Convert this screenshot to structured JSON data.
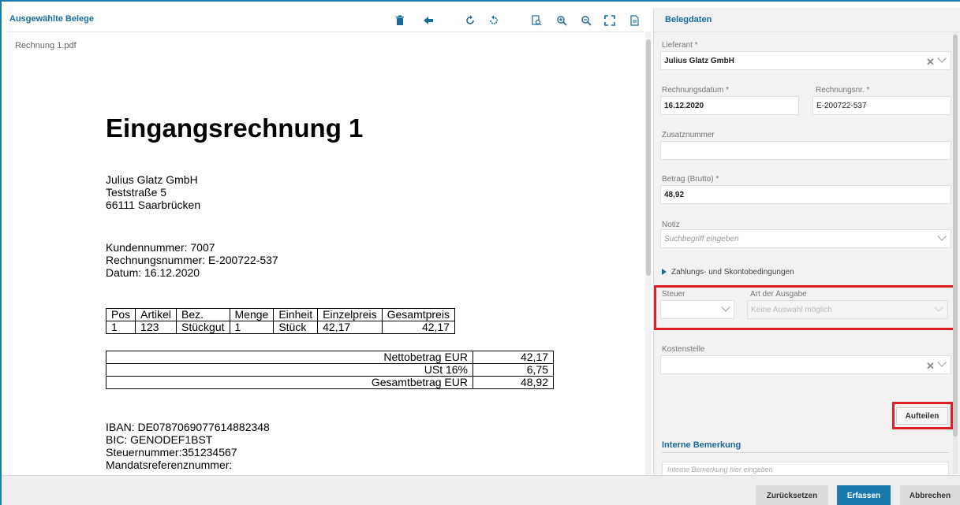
{
  "viewer": {
    "title": "Ausgewählte Belege",
    "filename": "Rechnung 1.pdf",
    "toolbar_icons": [
      "trash-icon",
      "arrow-left-icon",
      "rotate-cw-icon",
      "rotate-ccw-icon",
      "fit-page-icon",
      "zoom-in-icon",
      "zoom-out-icon",
      "fullscreen-icon",
      "document-icon"
    ]
  },
  "document": {
    "title": "Eingangsrechnung 1",
    "address": [
      "Julius Glatz GmbH",
      "Teststraße 5",
      "66111 Saarbrücken"
    ],
    "meta": [
      "Kundennummer: 7007",
      "Rechnungsnummer: E-200722-537",
      "Datum: 16.12.2020"
    ],
    "items_header": [
      "Pos",
      "Artikel",
      "Bez.",
      "Menge",
      "Einheit",
      "Einzelpreis",
      "Gesamtpreis"
    ],
    "items_rows": [
      [
        "1",
        "123",
        "Stückgut",
        "1",
        "Stück",
        "42,17",
        "42,17"
      ]
    ],
    "sums": [
      {
        "label": "Nettobetrag EUR",
        "value": "42,17"
      },
      {
        "label": "USt 16%",
        "value": "6,75"
      },
      {
        "label": "Gesamtbetrag EUR",
        "value": "48,92"
      }
    ],
    "bank": [
      "IBAN: DE07870690776148823​48",
      "BIC: GENODEF1BST",
      "Steuernummer:351234567",
      "Mandatsreferenznummer:"
    ]
  },
  "panel": {
    "title": "Belegdaten",
    "lieferant": {
      "label": "Lieferant *",
      "value": "Julius Glatz GmbH"
    },
    "rechnungsdatum": {
      "label": "Rechnungsdatum *",
      "value": "16.12.2020"
    },
    "rechnungsnr": {
      "label": "Rechnungsnr. *",
      "value": "E-200722-537"
    },
    "zusatznummer": {
      "label": "Zusatznummer",
      "value": ""
    },
    "betrag": {
      "label": "Betrag (Brutto) *",
      "value": "48,92"
    },
    "notiz": {
      "label": "Notiz",
      "placeholder": "Suchbegriff eingeben"
    },
    "zahlung": "Zahlungs- und Skontobedingungen",
    "steuer": {
      "label": "Steuer",
      "value": ""
    },
    "art": {
      "label": "Art der Ausgabe",
      "value": "Keine Auswahl möglich"
    },
    "kostenstelle": {
      "label": "Kostenstelle",
      "value": ""
    },
    "aufteilen": "Aufteilen",
    "interne_heading": "Interne Bemerkung",
    "interne_placeholder": "Interne Bemerkung hier eingeben"
  },
  "footer": {
    "reset": "Zurücksetzen",
    "submit": "Erfassen",
    "cancel": "Abbrechen"
  },
  "colors": {
    "accent": "#1a7ab0",
    "highlight": "#e11e26"
  }
}
